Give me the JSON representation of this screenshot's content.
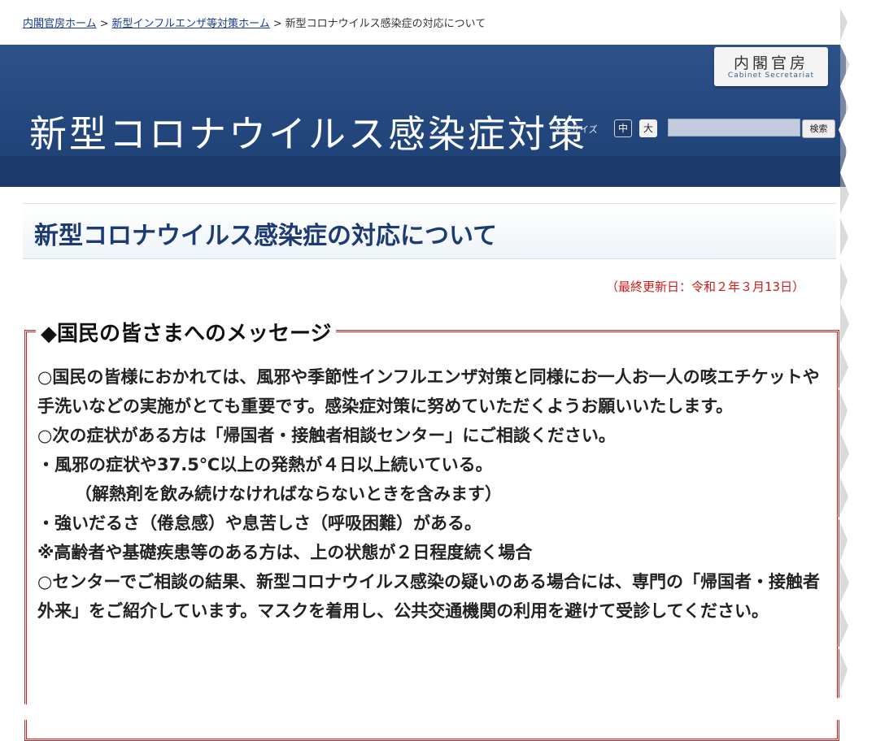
{
  "breadcrumb": {
    "items": [
      "内閣官房ホーム",
      "新型インフルエンザ等対策ホーム"
    ],
    "current": "新型コロナウイルス感染症の対応について",
    "separator": ">"
  },
  "header": {
    "site_title": "新型コロナウイルス感染症対策",
    "logo_jp": "内閣官房",
    "logo_en": "Cabinet Secretariat",
    "font_size_label": "文字サイズ",
    "font_mid": "中",
    "font_big": "大",
    "search_value": "",
    "search_button": "検索"
  },
  "page": {
    "title": "新型コロナウイルス感染症の対応について",
    "updated": "（最終更新日：令和２年３月13日）"
  },
  "message": {
    "heading": "◆国民の皆さまへのメッセージ",
    "lines": [
      "○国民の皆様におかれては、風邪や季節性インフルエンザ対策と同様にお一人お一人の咳エチケットや手洗いなどの実施がとても重要です。感染症対策に努めていただくようお願いいたします。",
      "○次の症状がある方は「帰国者・接触者相談センター」にご相談ください。",
      "・風邪の症状や37.5℃以上の発熱が４日以上続いている。",
      "（解熱剤を飲み続けなければならないときを含みます）",
      "・強いだるさ（倦怠感）や息苦しさ（呼吸困難）がある。",
      "※高齢者や基礎疾患等のある方は、上の状態が２日程度続く場合",
      "○センターでご相談の結果、新型コロナウイルス感染の疑いのある場合には、専門の「帰国者・接触者外来」をご紹介しています。マスクを着用し、公共交通機関の利用を避けて受診してください。"
    ]
  },
  "colors": {
    "header": "#2d528a",
    "title_blue": "#1d3b72",
    "updated_red": "#cc1a1a",
    "box_border": "#cc2222"
  }
}
